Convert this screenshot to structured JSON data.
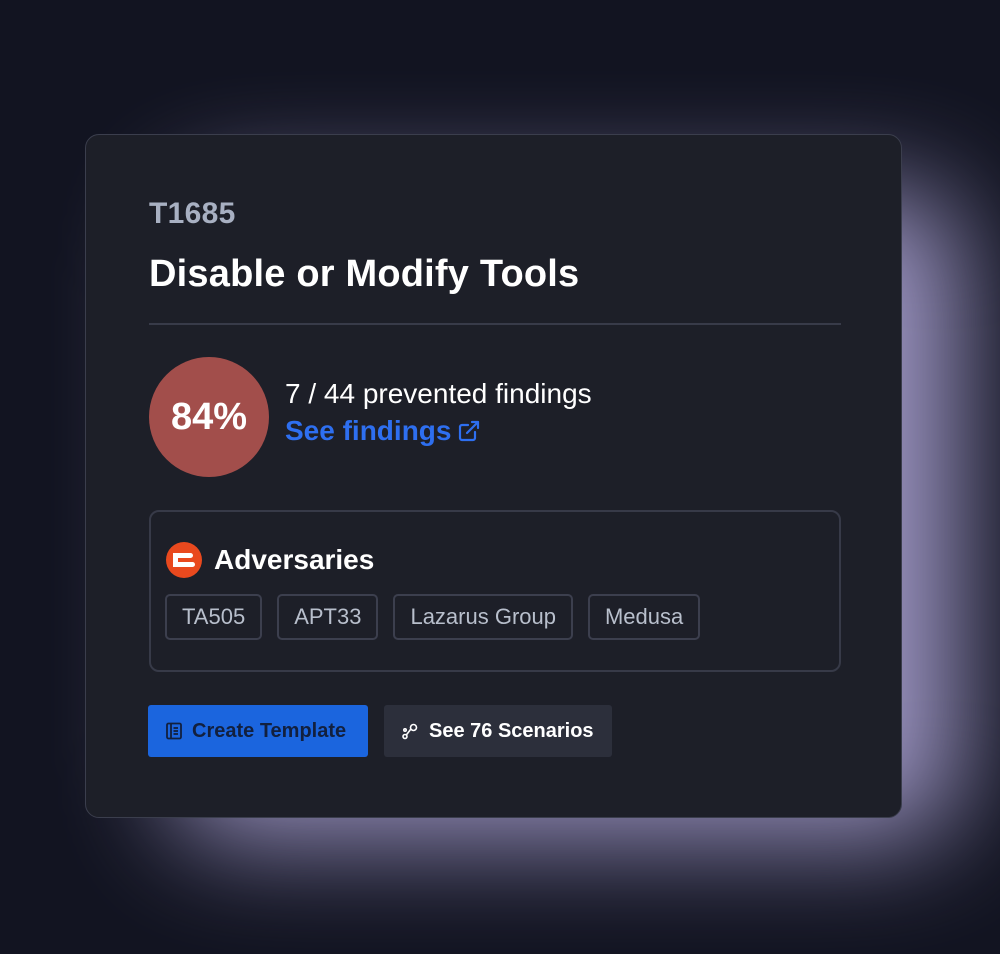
{
  "technique": {
    "id": "T1685",
    "title": "Disable or Modify Tools"
  },
  "score": {
    "percent_label": "84%",
    "percent_value": 84,
    "color": "#a24e4b",
    "findings_text": "7 / 44 prevented findings",
    "link_label": "See findings"
  },
  "adversaries": {
    "title": "Adversaries",
    "logo_icon": "adversary-brand-icon",
    "items": [
      "TA505",
      "APT33",
      "Lazarus Group",
      "Medusa"
    ]
  },
  "actions": {
    "create_template_label": "Create Template",
    "create_template_icon": "template-icon",
    "scenarios_label": "See 76 Scenarios",
    "scenarios_icon": "scenarios-icon"
  },
  "colors": {
    "accent": "#1b65de",
    "link": "#2e6ff0",
    "brand_orange": "#e9491e"
  }
}
